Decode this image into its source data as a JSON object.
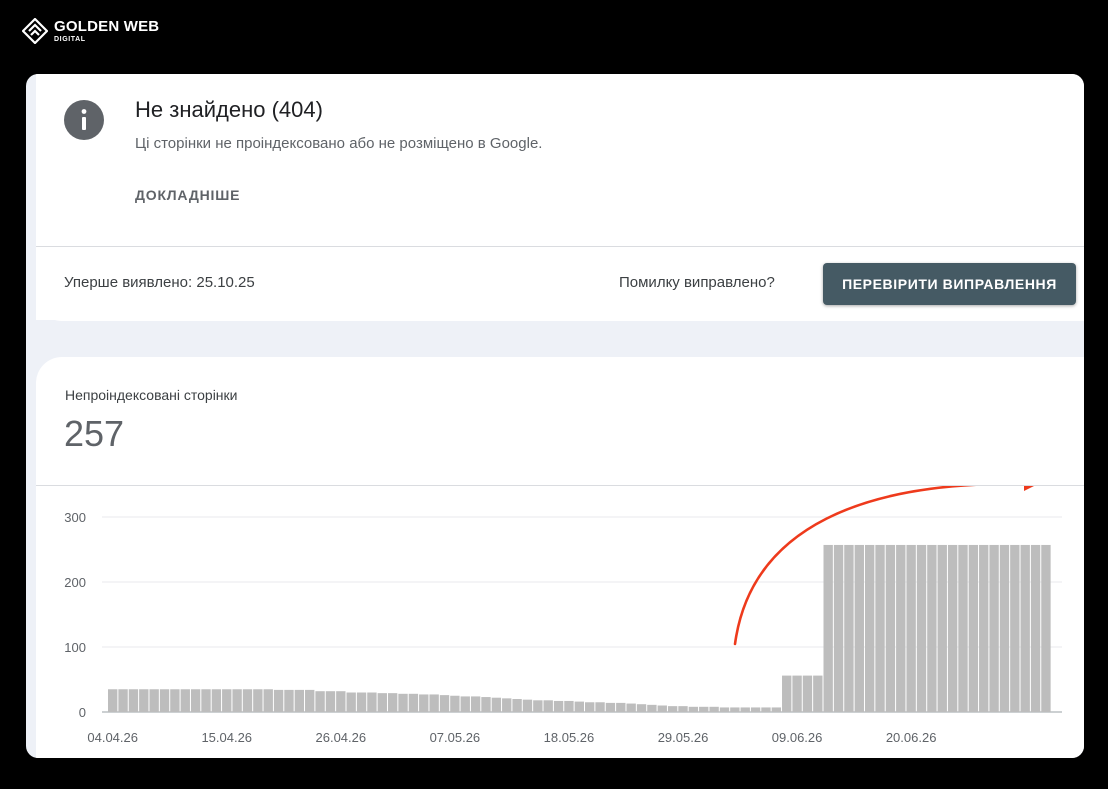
{
  "brand": {
    "name": "GOLDEN WEB",
    "sub": "DIGITAL"
  },
  "issue": {
    "icon": "info-icon",
    "title": "Не знайдено (404)",
    "description": "Ці сторінки не проіндексовано або не розміщено в Google.",
    "learn_more": "ДОКЛАДНІШЕ",
    "first_detected": "Уперше виявлено: 25.10.25",
    "fixed_question": "Помилку виправлено?",
    "validate_button": "ПЕРЕВІРИТИ ВИПРАВЛЕННЯ"
  },
  "metric": {
    "label": "Непроіндексовані сторінки",
    "value": "257"
  },
  "colors": {
    "bar": "#bdbdbd",
    "button": "#455a64",
    "arrow": "#ee3a1c",
    "grid": "#e8eaed",
    "frame": "#eef1f7"
  },
  "chart_data": {
    "type": "bar",
    "ylim": [
      0,
      300
    ],
    "y_ticks": [
      0,
      100,
      200,
      300
    ],
    "x_tick_labels": [
      "04.04.26",
      "15.04.26",
      "26.04.26",
      "07.05.26",
      "18.05.26",
      "29.05.26",
      "09.06.26",
      "20.06.26"
    ],
    "x_tick_indices": [
      0,
      11,
      22,
      33,
      44,
      55,
      66,
      77
    ],
    "grid": true,
    "annotation": "arrow-up-right",
    "values": [
      35,
      35,
      35,
      35,
      35,
      35,
      35,
      35,
      35,
      35,
      35,
      35,
      35,
      35,
      35,
      35,
      34,
      34,
      34,
      34,
      32,
      32,
      32,
      30,
      30,
      30,
      29,
      29,
      28,
      28,
      27,
      27,
      26,
      25,
      24,
      24,
      23,
      22,
      21,
      20,
      19,
      18,
      18,
      17,
      17,
      16,
      15,
      15,
      14,
      14,
      13,
      12,
      11,
      10,
      9,
      9,
      8,
      8,
      8,
      7,
      7,
      7,
      7,
      7,
      7,
      56,
      56,
      56,
      56,
      257,
      257,
      257,
      257,
      257,
      257,
      257,
      257,
      257,
      257,
      257,
      257,
      257,
      257,
      257,
      257,
      257,
      257,
      257,
      257,
      257,
      257
    ]
  }
}
